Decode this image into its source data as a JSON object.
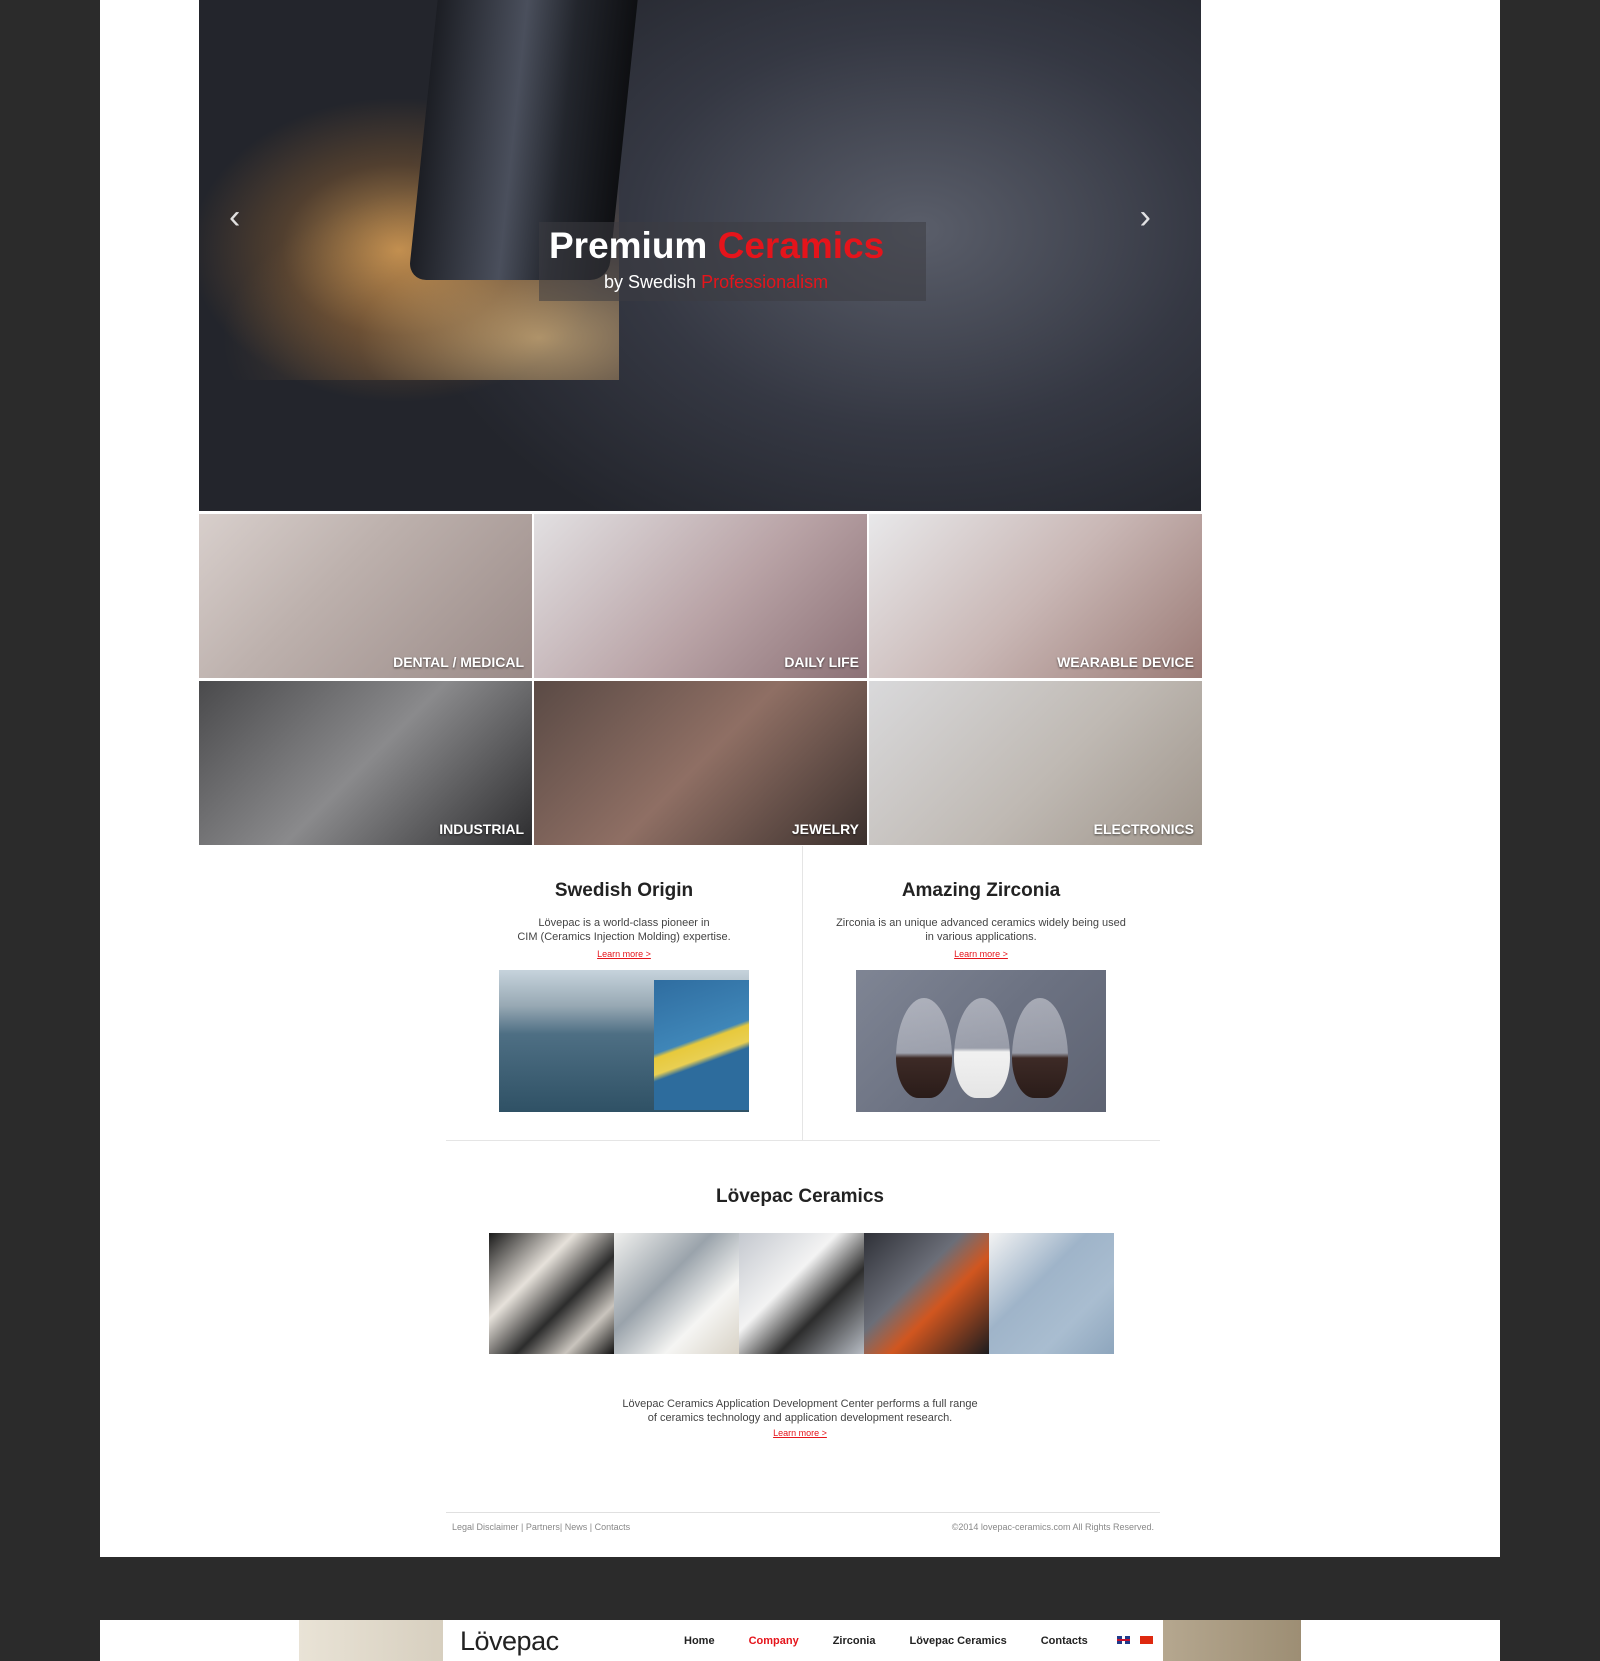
{
  "hero": {
    "title_white": "Premium ",
    "title_red": "Ceramics",
    "subtitle_white": "by Swedish ",
    "subtitle_red": "Professionalism",
    "prev_icon": "chevron-left-icon",
    "next_icon": "chevron-right-icon"
  },
  "categories": [
    {
      "label": "DENTAL / MEDICAL"
    },
    {
      "label": "DAILY LIFE"
    },
    {
      "label": "WEARABLE DEVICE"
    },
    {
      "label": "INDUSTRIAL"
    },
    {
      "label": "JEWELRY"
    },
    {
      "label": "ELECTRONICS"
    }
  ],
  "origin": {
    "title": "Swedish Origin",
    "line1": "Lövepac is a world-class pioneer in",
    "line2": "CIM (Ceramics Injection Molding) expertise.",
    "link": "Learn more >"
  },
  "zirconia": {
    "title": "Amazing Zirconia",
    "line1": "Zirconia is an unique advanced ceramics widely being used",
    "line2": "in various applications.",
    "link": "Learn more >"
  },
  "ceramics": {
    "title": "Lövepac Ceramics",
    "line1": "Lövepac Ceramics Application Development Center performs a full range",
    "line2": "of ceramics technology and application development research.",
    "link": "Learn more >"
  },
  "footer": {
    "legal": "Legal Disclaimer",
    "partners": "Partners",
    "news": "News",
    "contacts": "Contacts",
    "copyright": "©2014 lovepac-ceramics.com All Rights Reserved."
  },
  "nav": {
    "logo": "Lövepac",
    "items": [
      "Home",
      "Company",
      "Zirconia",
      "Lövepac Ceramics",
      "Contacts"
    ],
    "active": "Company"
  },
  "colors": {
    "accent": "#e5141b",
    "background": "#2b2b2b"
  }
}
